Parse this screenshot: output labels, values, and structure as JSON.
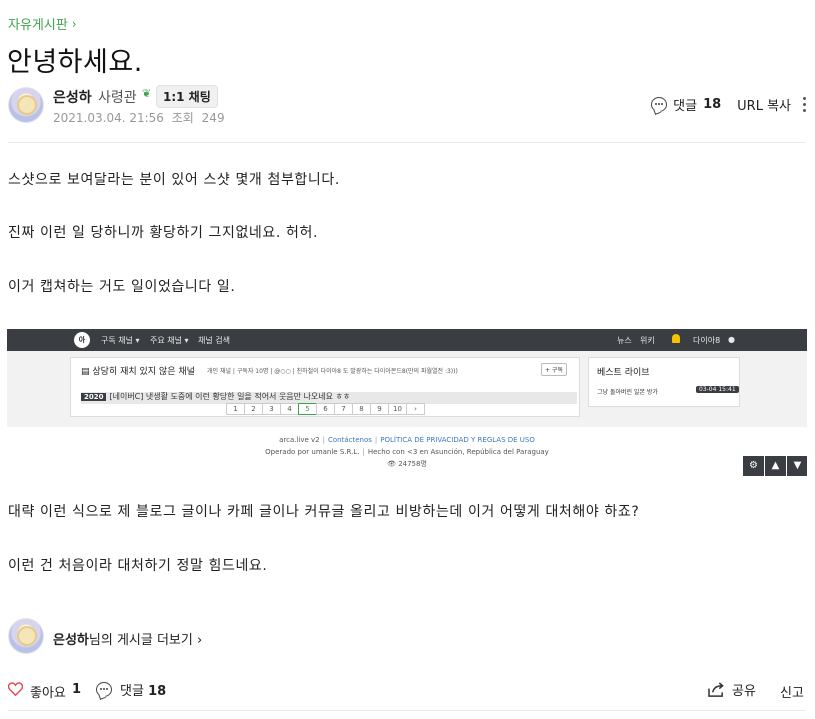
{
  "breadcrumb": {
    "board": "자유게시판",
    "chevron_icon": "chevron-right-icon"
  },
  "post": {
    "title": "안녕하세요.",
    "author": {
      "name": "은성하",
      "rank": "사령관",
      "rank_icon": "sprout-icon",
      "chat_label": "1:1 채팅"
    },
    "date": "2021.03.04. 21:56",
    "views_label": "조회",
    "views": "249",
    "comment_label": "댓글",
    "comment_count": "18",
    "url_copy_label": "URL 복사"
  },
  "body": {
    "p1": "스샷으로 보여달라는 분이 있어 스샷 몇개 첨부합니다.",
    "p2": "진짜 이런 일 당하니까 황당하기 그지없네요. 허허.",
    "p3": "이거 캡쳐하는 거도 일이었습니다 일.",
    "p4": "대략 이런 식으로 제 블로그 글이나 카페 글이나 커뮤글 올리고 비방하는데 이거 어떻게 대처해야 하죠?",
    "p5": "이런 건 처음이라 대처하기 정말 힘드네요."
  },
  "screenshot": {
    "logo": "아",
    "nav": [
      "구독 채널 ▾",
      "주요 채널 ▾",
      "채널 검색"
    ],
    "nav_right": [
      "뉴스",
      "위키"
    ],
    "user": "다이아8",
    "channel_title": "상당히 재치 있지 않은 채널",
    "channel_meta": "개인 채널 | 구독자 10명 | @○○ | 친하철이 다이아8 도 발광하는 다이아몬드8(만의 파월열전 :3)))",
    "subscribe": "+ 구독",
    "post_badge": "2020",
    "post_row": "[네이버C] 냇생활 도중에 이런 황당한 일을 적어서 웃음만 나오네요 ㅎㅎ",
    "pages": [
      "1",
      "2",
      "3",
      "4",
      "5",
      "6",
      "7",
      "8",
      "9",
      "10",
      "›"
    ],
    "best_title": "베스트 라이브",
    "best_item": "그냥 돌아버린 일본 방가",
    "best_date": "03-04 15:41",
    "footer_line1_a": "arca.live v2",
    "footer_line1_b": "Contáctenos",
    "footer_line1_c": "POLÍTICA DE PRIVACIDAD Y REGLAS DE USO",
    "footer_line2_a": "Operado por umanle S.R.L.",
    "footer_line2_b": "Hecho con <3 en Asunción, República del Paraguay",
    "footer_line3": "👁 24758명"
  },
  "more_posts": {
    "author": "은성하",
    "suffix": "님의 게시글 더보기 ›"
  },
  "actions": {
    "like_label": "좋아요",
    "like_count": "1",
    "comment_label": "댓글",
    "comment_count": "18",
    "share_label": "공유",
    "report_label": "신고"
  },
  "colors": {
    "accent_green": "#3fa34d",
    "heart_red": "#e0474c",
    "dark_bar": "#3a3d42"
  }
}
